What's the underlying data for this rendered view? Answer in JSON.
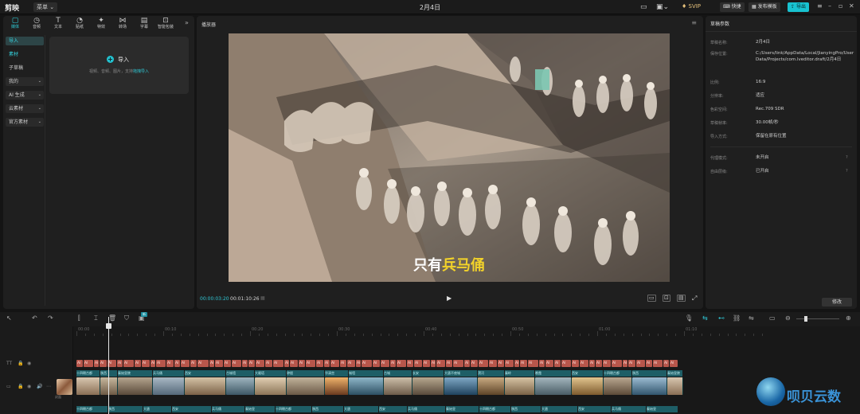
{
  "topbar": {
    "logo": "剪映",
    "menu": "菜单",
    "title": "2月4日",
    "svip": "SVIP",
    "shortcut": "快捷",
    "publish_template": "发布模板",
    "export": "导出"
  },
  "tools": [
    {
      "label": "媒体",
      "icon": "▢"
    },
    {
      "label": "音频",
      "icon": "◷"
    },
    {
      "label": "文本",
      "icon": "T"
    },
    {
      "label": "贴纸",
      "icon": "◔"
    },
    {
      "label": "特效",
      "icon": "✦"
    },
    {
      "label": "转场",
      "icon": "⋈"
    },
    {
      "label": "字幕",
      "icon": "▤"
    },
    {
      "label": "智能包装",
      "icon": "⊡"
    }
  ],
  "sidebar": [
    {
      "label": "导入",
      "state": "selected"
    },
    {
      "label": "素材",
      "state": "selected-text"
    },
    {
      "label": "子草稿",
      "state": ""
    },
    {
      "label": "我的",
      "state": "box",
      "caret": "⌄"
    },
    {
      "label": "AI 生成",
      "state": "box",
      "caret": "⌄"
    },
    {
      "label": "云素材",
      "state": "box",
      "caret": "⌄"
    },
    {
      "label": "官方素材",
      "state": "box",
      "caret": "⌄"
    }
  ],
  "import_card": {
    "label": "导入",
    "hint": "视频、音频、图片，支持",
    "hint_link": "拖拽导入"
  },
  "player": {
    "title": "播放器",
    "subtitle_plain": "只有",
    "subtitle_highlight": "兵马俑",
    "current_time": "00:00:03:20",
    "total_time": "00:01:10:26"
  },
  "draft": {
    "header": "草稿参数",
    "rows": [
      {
        "label": "草稿名称:",
        "value": "2月4日"
      },
      {
        "label": "保存位置:",
        "value": "C:/Users/link/AppData/Local/JianyingPro/User Data/Projects/com.lveditor.draft/2月4日"
      },
      {
        "label": "比例:",
        "value": "16:9"
      },
      {
        "label": "分辨率:",
        "value": "适应"
      },
      {
        "label": "色彩空间:",
        "value": "Rec.709 SDR"
      },
      {
        "label": "草稿帧率:",
        "value": "30.00帧/秒"
      },
      {
        "label": "导入方式:",
        "value": "保留在原有位置"
      },
      {
        "label": "代理模式:",
        "value": "未开启"
      },
      {
        "label": "自由层级:",
        "value": "已开启"
      }
    ],
    "edit_button": "修改"
  },
  "timeline": {
    "badge": "新",
    "ruler": [
      "00:00",
      "00:10",
      "00:20",
      "00:30",
      "00:40",
      "00:50",
      "01:00",
      "01:10"
    ],
    "cover": "封面",
    "text_clip_label": "AI",
    "video_labels": [
      "十四朝古都",
      "陕西",
      "秦始皇陵",
      "兵马俑",
      "西安",
      "古城墙",
      "大雁塔",
      "钟楼",
      "华清宫",
      "城墙",
      "古城",
      "长安",
      "大唐不夜城",
      "渭河",
      "秦岭",
      "晚霞",
      "西安"
    ],
    "audio_labels": [
      "十四朝古都",
      "陕西",
      "大唐",
      "西安",
      "兵马俑",
      "秦始皇"
    ]
  },
  "watermark": "呗贝云数"
}
